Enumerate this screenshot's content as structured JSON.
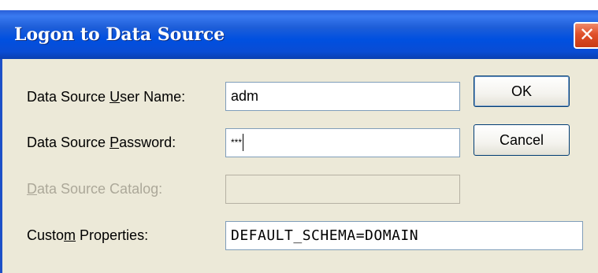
{
  "window": {
    "title": "Logon to Data Source",
    "close_glyph": "✕"
  },
  "form": {
    "user_name_label_pre": "Data Source ",
    "user_name_label_accel": "U",
    "user_name_label_post": "ser Name:",
    "user_name_value": "adm",
    "password_label_pre": "Data Source ",
    "password_label_accel": "P",
    "password_label_post": "assword:",
    "password_value": "***",
    "catalog_label_pre": "",
    "catalog_label_accel": "D",
    "catalog_label_post": "ata Source Catalog:",
    "catalog_value": "",
    "custom_label_pre": "Custo",
    "custom_label_accel": "m",
    "custom_label_post": " Properties:",
    "custom_value": "DEFAULT_SCHEMA=DOMAIN"
  },
  "buttons": {
    "ok_label": "OK",
    "cancel_label": "Cancel"
  },
  "colors": {
    "title_bar": "#0a4cd4",
    "dialog_face": "#ece9d8",
    "close_button": "#e0502a",
    "disabled_text": "#aca899"
  },
  "icons": {
    "close": "close-icon"
  }
}
